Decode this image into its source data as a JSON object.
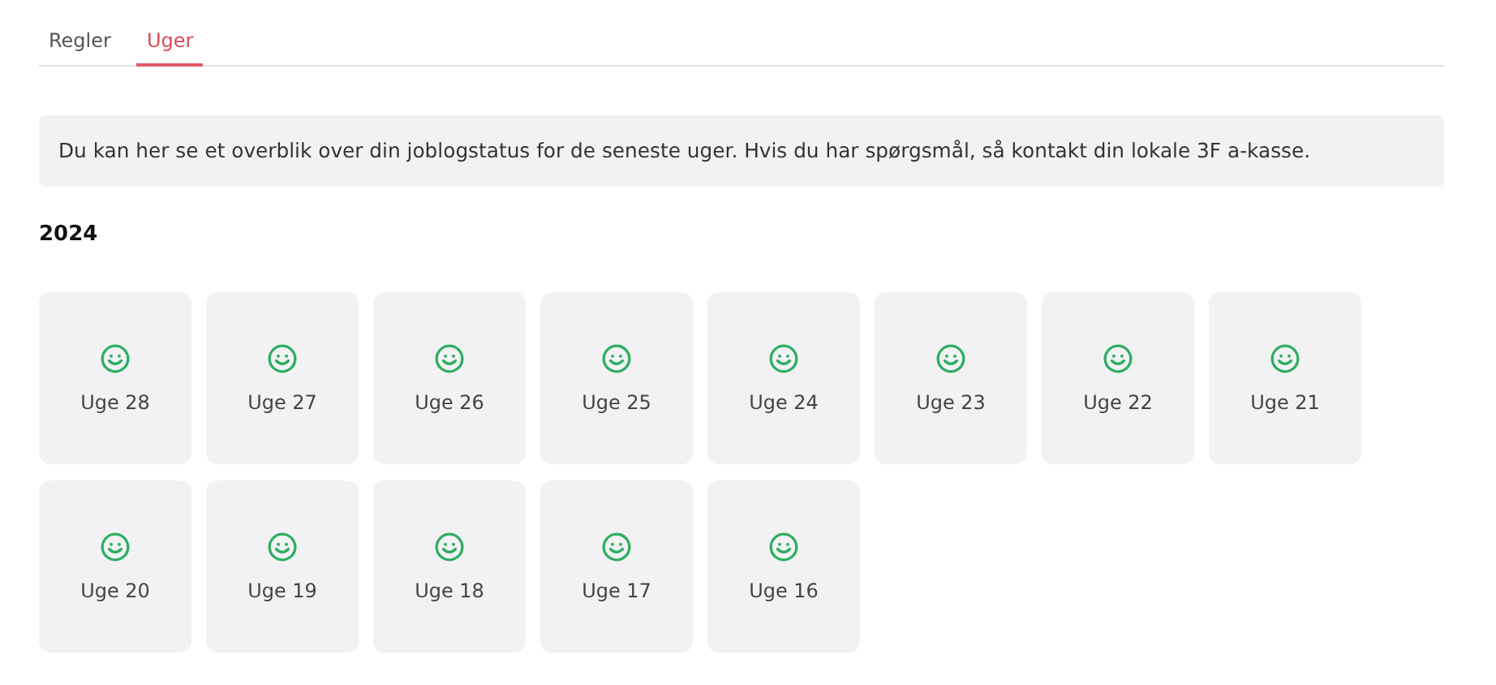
{
  "tabs": [
    {
      "label": "Regler",
      "selected": false
    },
    {
      "label": "Uger",
      "selected": true
    }
  ],
  "info": "Du kan her se et overblik over din joblogstatus for de seneste uger. Hvis du har spørgsmål, så kontakt din lokale 3F a-kasse.",
  "year": "2024",
  "weeks": [
    {
      "label": "Uge 28",
      "ok": true
    },
    {
      "label": "Uge 27",
      "ok": true
    },
    {
      "label": "Uge 26",
      "ok": true
    },
    {
      "label": "Uge 25",
      "ok": true
    },
    {
      "label": "Uge 24",
      "ok": true
    },
    {
      "label": "Uge 23",
      "ok": true
    },
    {
      "label": "Uge 22",
      "ok": true
    },
    {
      "label": "Uge 21",
      "ok": true
    },
    {
      "label": "Uge 20",
      "ok": true
    },
    {
      "label": "Uge 19",
      "ok": true
    },
    {
      "label": "Uge 18",
      "ok": true
    },
    {
      "label": "Uge 17",
      "ok": true
    },
    {
      "label": "Uge 16",
      "ok": true
    }
  ]
}
